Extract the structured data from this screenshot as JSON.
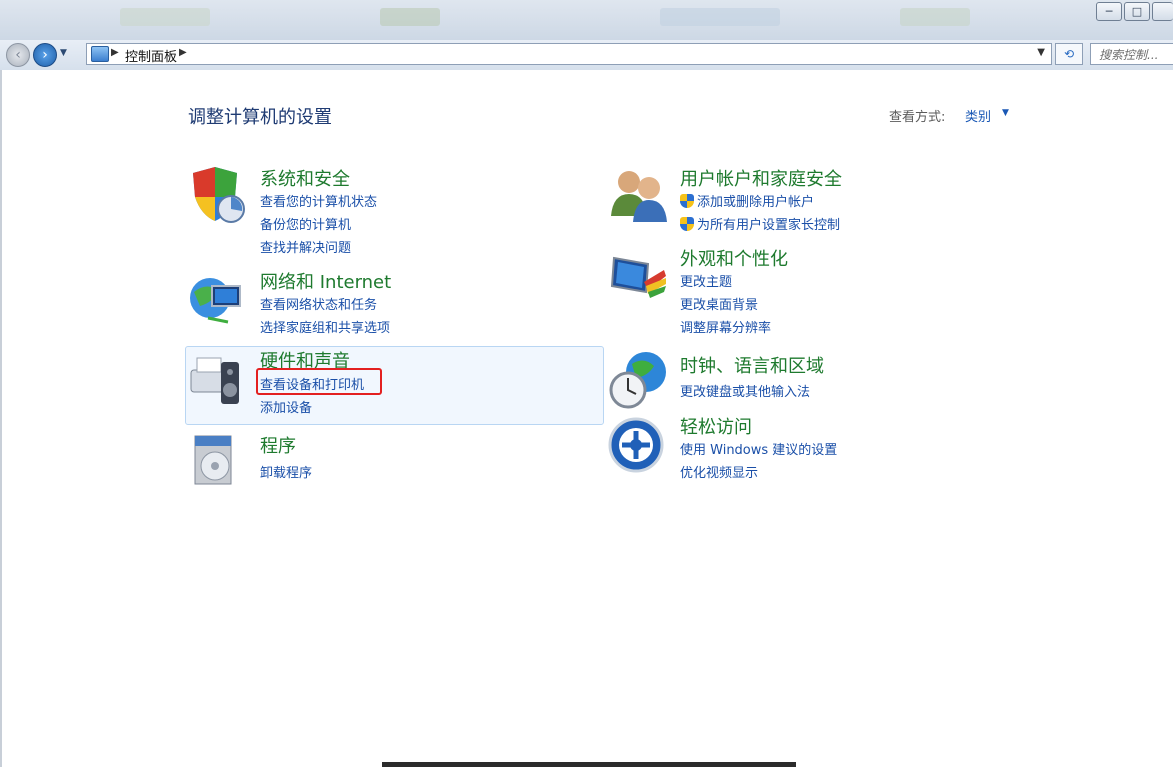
{
  "window": {
    "minimize_glyph": "─",
    "maximize_glyph": "□"
  },
  "navigation": {
    "back_icon": "‹",
    "forward_icon": "›",
    "breadcrumb": [
      "控制面板"
    ],
    "search_placeholder": "搜索控制..."
  },
  "header": {
    "title": "调整计算机的设置",
    "view_by_label": "查看方式:",
    "view_by_value": "类别"
  },
  "categories": [
    {
      "title": "系统和安全",
      "icon": "shield-icon",
      "links": [
        "查看您的计算机状态",
        "备份您的计算机",
        "查找并解决问题"
      ]
    },
    {
      "title": "网络和 Internet",
      "icon": "network-globe-icon",
      "links": [
        "查看网络状态和任务",
        "选择家庭组和共享选项"
      ]
    },
    {
      "title": "硬件和声音",
      "icon": "printer-speaker-icon",
      "links": [
        "查看设备和打印机",
        "添加设备"
      ]
    },
    {
      "title": "程序",
      "icon": "programs-disc-icon",
      "links": [
        "卸载程序"
      ]
    },
    {
      "title": "用户帐户和家庭安全",
      "icon": "users-icon",
      "links": [
        "添加或删除用户帐户",
        "为所有用户设置家长控制"
      ]
    },
    {
      "title": "外观和个性化",
      "icon": "monitor-palette-icon",
      "links": [
        "更改主题",
        "更改桌面背景",
        "调整屏幕分辨率"
      ]
    },
    {
      "title": "时钟、语言和区域",
      "icon": "clock-globe-icon",
      "links": [
        "更改键盘或其他输入法"
      ]
    },
    {
      "title": "轻松访问",
      "icon": "ease-of-access-icon",
      "links": [
        "使用 Windows 建议的设置",
        "优化视频显示"
      ]
    }
  ],
  "colors": {
    "category_title": "#1e7a2e",
    "link": "#1a4fa8",
    "highlight_border": "#e32020"
  }
}
